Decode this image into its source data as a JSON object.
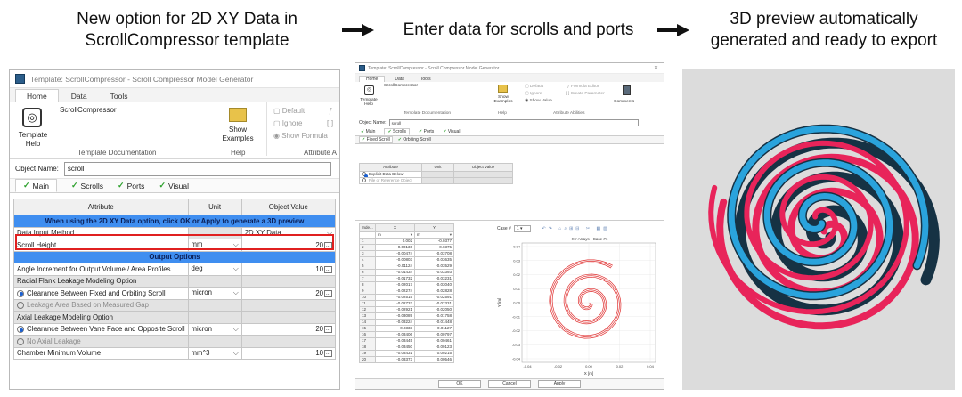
{
  "captions": {
    "step1": [
      "New option for 2D XY Data in",
      "ScrollCompressor template"
    ],
    "step2": "Enter data for scrolls and ports",
    "step3": [
      "3D preview automatically",
      "generated and ready to export"
    ]
  },
  "panel1": {
    "title": "Template: ScrollCompressor - Scroll Compressor Model Generator",
    "tabs": [
      "Home",
      "Data",
      "Tools"
    ],
    "ribbon": {
      "template_name": "ScrollCompressor",
      "help_label": "Template\nHelp",
      "show_examples": "Show\nExamples",
      "default": "Default",
      "ignore": "Ignore",
      "show_formula": "Show Formula",
      "group_doc": "Template Documentation",
      "group_help": "Help",
      "group_attr": "Attribute A"
    },
    "object_name_label": "Object Name:",
    "object_name_value": "scroll",
    "subtabs": [
      "Main",
      "Scrolls",
      "Ports",
      "Visual"
    ],
    "headers": [
      "Attribute",
      "Unit",
      "Object Value"
    ],
    "info_row": "When using the 2D XY Data option, click OK or Apply to generate a 3D preview",
    "rows": [
      {
        "attr": "Data Input Method",
        "unit": "",
        "value": "2D XY Data",
        "kind": "dropdown"
      },
      {
        "attr": "Scroll Height",
        "unit": "mm",
        "value": "20",
        "kind": "num"
      },
      {
        "attr": "Output Options",
        "kind": "section"
      },
      {
        "attr": "Angle Increment for Output Volume / Area Profiles",
        "unit": "deg",
        "value": "10",
        "kind": "num"
      },
      {
        "attr": "Radial Flank Leakage Modeling Option",
        "kind": "group"
      },
      {
        "attr": "Clearance Between Fixed and Orbiting Scroll",
        "unit": "micron",
        "value": "20",
        "kind": "radio-on"
      },
      {
        "attr": "Leakage Area Based on Measured Gap",
        "kind": "radio-off"
      },
      {
        "attr": "Axial Leakage Modeling Option",
        "kind": "group"
      },
      {
        "attr": "Clearance Between Vane Face and Opposite Scroll",
        "unit": "micron",
        "value": "20",
        "kind": "radio-on"
      },
      {
        "attr": "No Axial Leakage",
        "kind": "radio-off"
      },
      {
        "attr": "Chamber Minimum Volume",
        "unit": "mm^3",
        "value": "10",
        "kind": "num"
      }
    ]
  },
  "panel2": {
    "title": "Template: ScrollCompressor - Scroll Compressor Model Generator",
    "tabs": [
      "Home",
      "Data",
      "Tools"
    ],
    "ribbon": {
      "template_name": "ScrollCompressor",
      "help_label": "Template Help",
      "show_examples": "Show Examples",
      "default": "Default",
      "ignore": "Ignore",
      "show_value": "Show Value",
      "formula_editor": "Formula Editor",
      "create_parameter": "Create Parameter",
      "comments": "Comments",
      "group_doc": "Template Documentation",
      "group_help": "Help",
      "group_attr": "Attribute Abilities"
    },
    "object_name_label": "Object Name:",
    "object_name_value": "scroll",
    "subtabs": [
      "Main",
      "Scrolls",
      "Ports",
      "Visual"
    ],
    "subtabs2": [
      "Fixed Scroll",
      "Orbiting Scroll"
    ],
    "attr_headers": [
      "Attribute",
      "Unit",
      "Object Value"
    ],
    "attr_rows": [
      "Explicit Data Below",
      "File or Reference Object"
    ],
    "xy_headers": [
      "Inde...",
      "X",
      "Y"
    ],
    "xy_units": [
      "m",
      "m"
    ],
    "xy_rows": [
      [
        "1",
        "0.002",
        "-0.0377"
      ],
      [
        "2",
        "-0.00136",
        "-0.0375"
      ],
      [
        "3",
        "-0.00474",
        "-0.03708"
      ],
      [
        "4",
        "-0.00803",
        "-0.03635"
      ],
      [
        "5",
        "-0.01124",
        "-0.03529"
      ],
      [
        "6",
        "-0.01434",
        "-0.03393"
      ],
      [
        "7",
        "-0.01732",
        "-0.03231"
      ],
      [
        "8",
        "-0.02017",
        "-0.03040"
      ],
      [
        "9",
        "-0.02274",
        "-0.02828"
      ],
      [
        "10",
        "-0.02515",
        "-0.02591"
      ],
      [
        "11",
        "-0.02732",
        "-0.02331"
      ],
      [
        "12",
        "-0.02921",
        "-0.02050"
      ],
      [
        "13",
        "-0.03089",
        "-0.01758"
      ],
      [
        "14",
        "-0.03224",
        "-0.01448"
      ],
      [
        "15",
        "-0.0333",
        "-0.01127"
      ],
      [
        "16",
        "-0.03406",
        "-0.00797"
      ],
      [
        "17",
        "-0.03445",
        "-0.00461"
      ],
      [
        "18",
        "-0.03450",
        "-0.00123"
      ],
      [
        "19",
        "-0.03431",
        "0.00215"
      ],
      [
        "20",
        "-0.03373",
        "0.00546"
      ]
    ],
    "plot": {
      "case_label": "Case #",
      "case_value": "1",
      "title": "XY Arrays - Case #1",
      "xlabel": "X [m]",
      "ylabel": "Y [m]",
      "xticks": [
        "-0.04",
        "-0.02",
        "0.00",
        "0.02",
        "0.04"
      ],
      "yticks": [
        "0.04",
        "0.03",
        "0.02",
        "0.01",
        "0.00",
        "-0.01",
        "-0.02",
        "-0.03",
        "-0.04"
      ],
      "line_color": "#e03030"
    },
    "footer": [
      "OK",
      "Cancel",
      "Apply"
    ]
  },
  "panel3": {
    "colors": {
      "blue": "#2aa3dc",
      "red": "#e8245a",
      "dark": "#163244",
      "bg": "#dcdcdc"
    }
  }
}
